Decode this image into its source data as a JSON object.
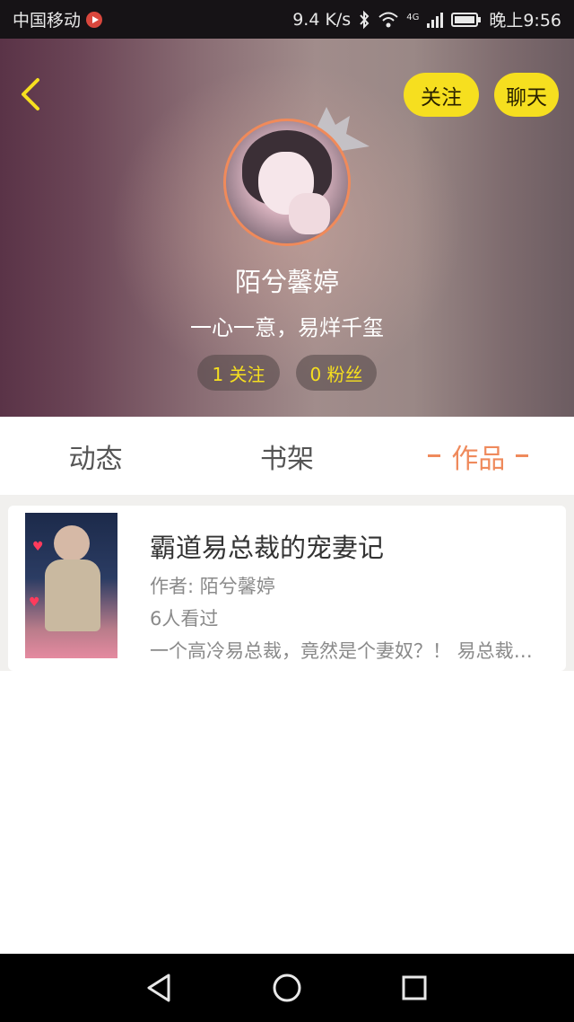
{
  "status_bar": {
    "carrier": "中国移动",
    "network_speed": "9.4 K/s",
    "network_type": "4G",
    "time": "晚上9:56"
  },
  "header": {
    "follow_button": "关注",
    "chat_button": "聊天",
    "username": "陌兮馨婷",
    "bio": "一心一意，易烊千玺",
    "following_stat": "1 关注",
    "fans_stat": "0 粉丝",
    "accent_color": "#f6df1f",
    "avatar_border_color": "#f08a5a"
  },
  "tabs": [
    {
      "label": "动态",
      "active": false
    },
    {
      "label": "书架",
      "active": false
    },
    {
      "label": "作品",
      "active": true
    }
  ],
  "works": [
    {
      "title": "霸道易总裁的宠妻记",
      "author": "作者: 陌兮馨婷",
      "views": "6人看过",
      "description": "一个高冷易总裁，竟然是个妻奴？！ 易总裁：这个妻子，我一定要宠到底"
    }
  ],
  "nav_bar": {
    "icons": [
      "back-triangle-icon",
      "home-circle-icon",
      "recents-square-icon"
    ]
  }
}
